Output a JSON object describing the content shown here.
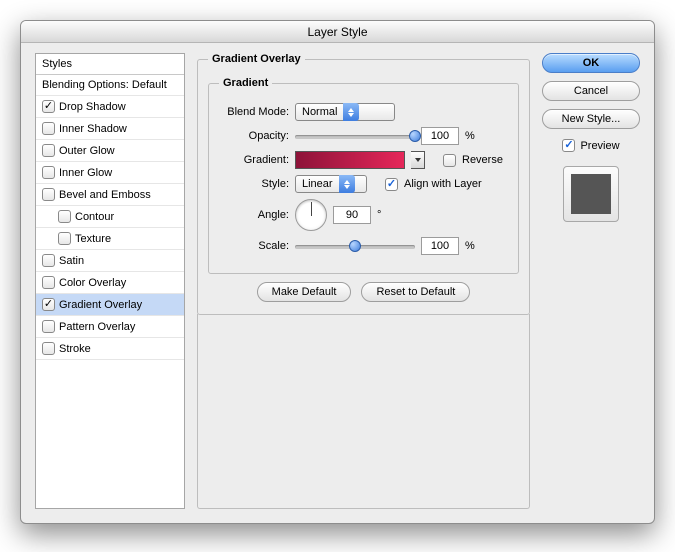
{
  "title": "Layer Style",
  "styles_panel": {
    "header": "Styles",
    "blending_label": "Blending Options: Default",
    "items": [
      {
        "label": "Drop Shadow",
        "checked": true
      },
      {
        "label": "Inner Shadow",
        "checked": false
      },
      {
        "label": "Outer Glow",
        "checked": false
      },
      {
        "label": "Inner Glow",
        "checked": false
      },
      {
        "label": "Bevel and Emboss",
        "checked": false
      },
      {
        "label": "Contour",
        "checked": false,
        "sub": true
      },
      {
        "label": "Texture",
        "checked": false,
        "sub": true
      },
      {
        "label": "Satin",
        "checked": false
      },
      {
        "label": "Color Overlay",
        "checked": false
      },
      {
        "label": "Gradient Overlay",
        "checked": true,
        "selected": true
      },
      {
        "label": "Pattern Overlay",
        "checked": false
      },
      {
        "label": "Stroke",
        "checked": false
      }
    ]
  },
  "section_title": "Gradient Overlay",
  "gradient_group": "Gradient",
  "labels": {
    "blend_mode": "Blend Mode:",
    "opacity": "Opacity:",
    "gradient": "Gradient:",
    "reverse": "Reverse",
    "style": "Style:",
    "align": "Align with Layer",
    "angle": "Angle:",
    "scale": "Scale:"
  },
  "values": {
    "blend_mode": "Normal",
    "opacity": "100",
    "opacity_unit": "%",
    "style": "Linear",
    "angle": "90",
    "angle_unit": "°",
    "scale": "100",
    "scale_unit": "%",
    "reverse_checked": false,
    "align_checked": true,
    "gradient_stops": [
      "#8d1238",
      "#e6275a"
    ]
  },
  "buttons": {
    "make_default": "Make Default",
    "reset_default": "Reset to Default",
    "ok": "OK",
    "cancel": "Cancel",
    "new_style": "New Style...",
    "preview": "Preview",
    "preview_checked": true
  }
}
